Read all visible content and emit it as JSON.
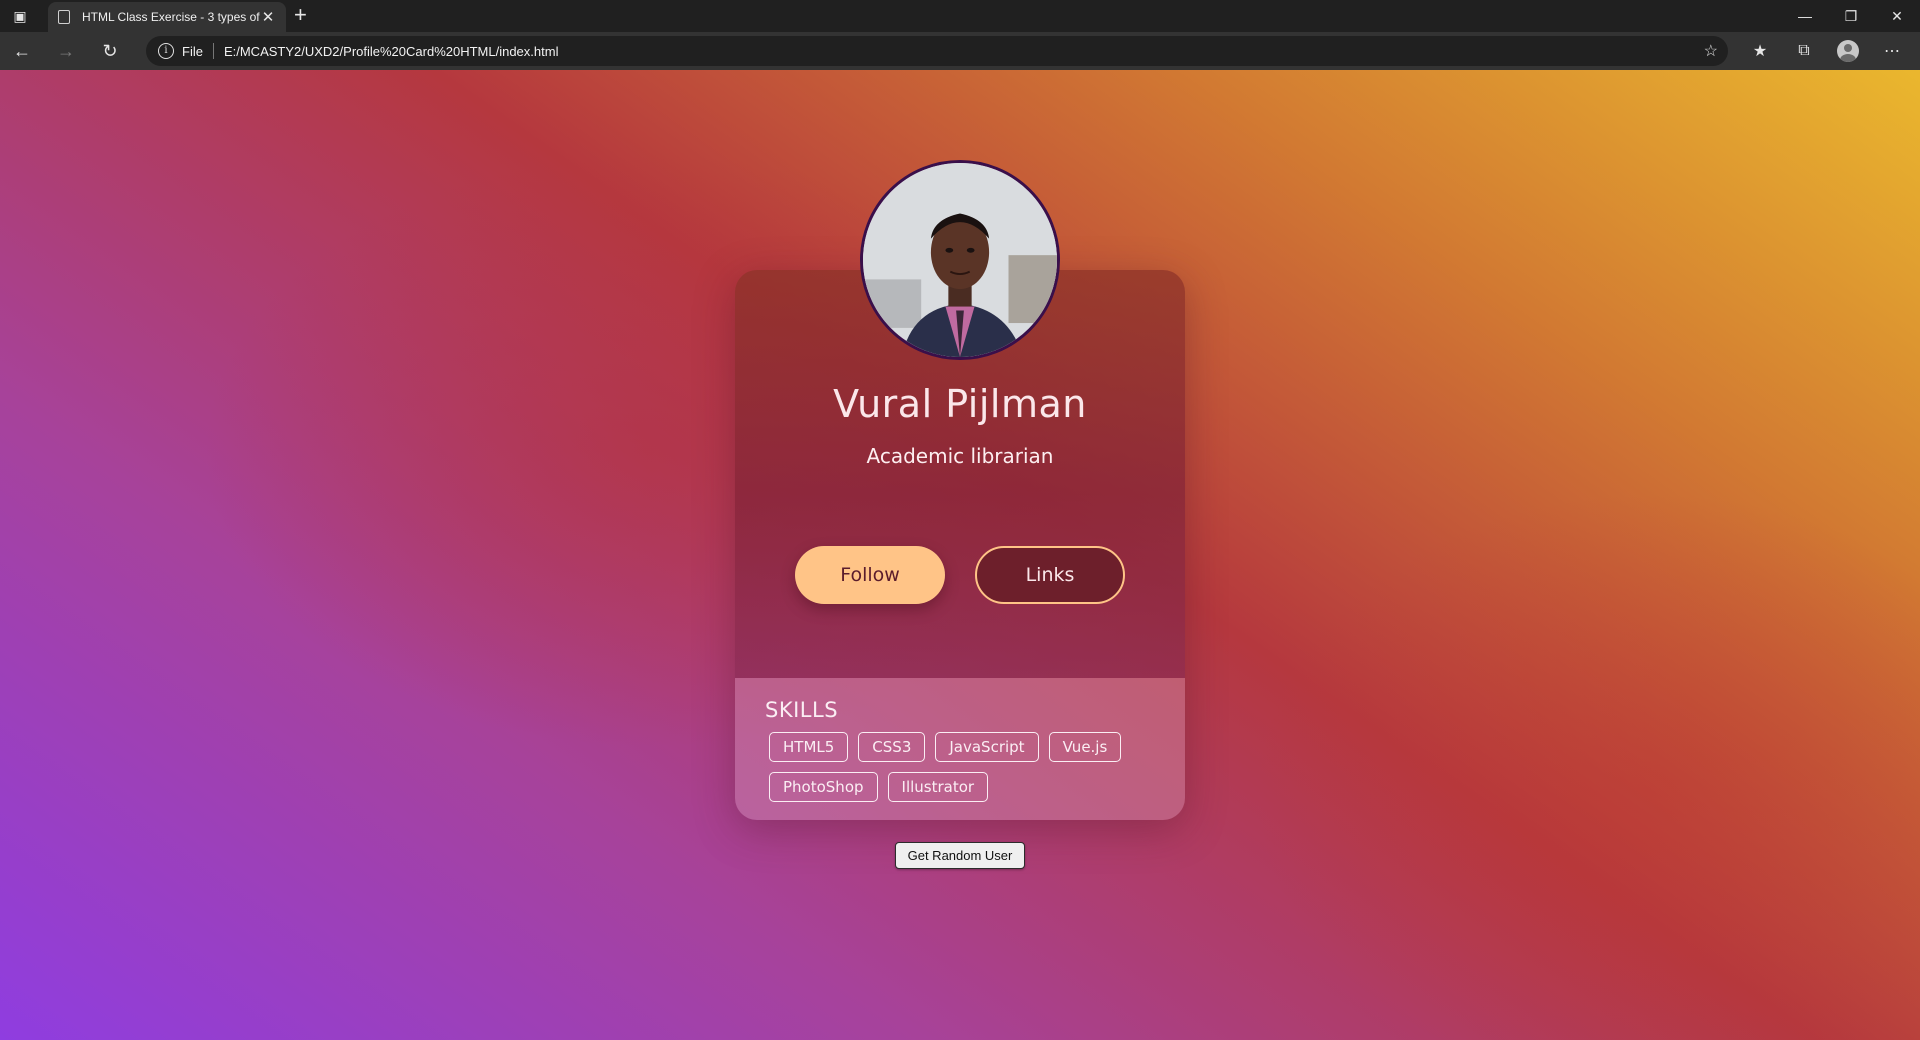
{
  "browser": {
    "tab_title": "HTML Class Exercise - 3 types of",
    "address_scheme": "File",
    "address_url": "E:/MCASTY2/UXD2/Profile%20Card%20HTML/index.html",
    "icons": {
      "sidebar": "tab-actions-icon",
      "tab_page": "document-icon",
      "tab_close": "close-icon",
      "new_tab": "plus-icon",
      "back": "back-arrow-icon",
      "forward": "forward-arrow-icon",
      "reload": "reload-icon",
      "info": "info-icon",
      "add_favorite": "star-plus-icon",
      "favorites": "favorites-icon",
      "collections": "collections-icon",
      "profile": "profile-avatar-icon",
      "more": "more-icon",
      "minimize": "minimize-icon",
      "restore": "restore-icon",
      "close_window": "close-window-icon"
    }
  },
  "profile": {
    "name": "Vural Pijlman",
    "job_title": "Academic librarian",
    "follow_label": "Follow",
    "links_label": "Links"
  },
  "skills": {
    "title": "SKILLS",
    "items": [
      "HTML5",
      "CSS3",
      "JavaScript",
      "Vue.js",
      "PhotoShop",
      "Illustrator"
    ]
  },
  "random_user_button": "Get Random User",
  "colors": {
    "follow_bg": "#ffc487",
    "links_bg": "#6d1f2b",
    "accent_text": "#fbe7ea"
  }
}
